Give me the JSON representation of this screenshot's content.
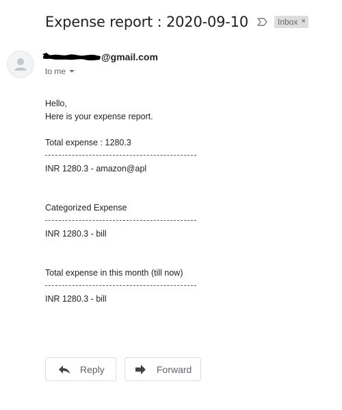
{
  "email": {
    "subject": "Expense report : 2020-09-10",
    "labels": [
      {
        "name": "Inbox",
        "close_glyph": "×"
      }
    ],
    "importance_icon": "importance-marker-icon"
  },
  "sender": {
    "avatar_icon": "default-avatar-icon",
    "name_visible": "@gmail.com",
    "name_redacted": true,
    "recipient": "to me",
    "recipient_dropdown_icon": "caret-down-icon"
  },
  "message": {
    "greeting": "Hello,",
    "intro": "Here is your expense report.",
    "total_line": "Total expense : 1280.3",
    "divider": "--------------------------------------------------------",
    "total_detail": "INR 1280.3 - amazon@apl",
    "category_heading": "Categorized Expense",
    "category_detail": "INR 1280.3 - bill",
    "month_heading": "Total expense in this month (till now)",
    "month_detail": "INR 1280.3 - bill"
  },
  "actions": {
    "reply_label": "Reply",
    "reply_icon": "reply-arrow-icon",
    "forward_label": "Forward",
    "forward_icon": "forward-arrow-icon"
  },
  "colors": {
    "text": "#222222",
    "muted": "#5f6368",
    "chip_bg": "#dddddd",
    "button_border": "#dadce0"
  }
}
